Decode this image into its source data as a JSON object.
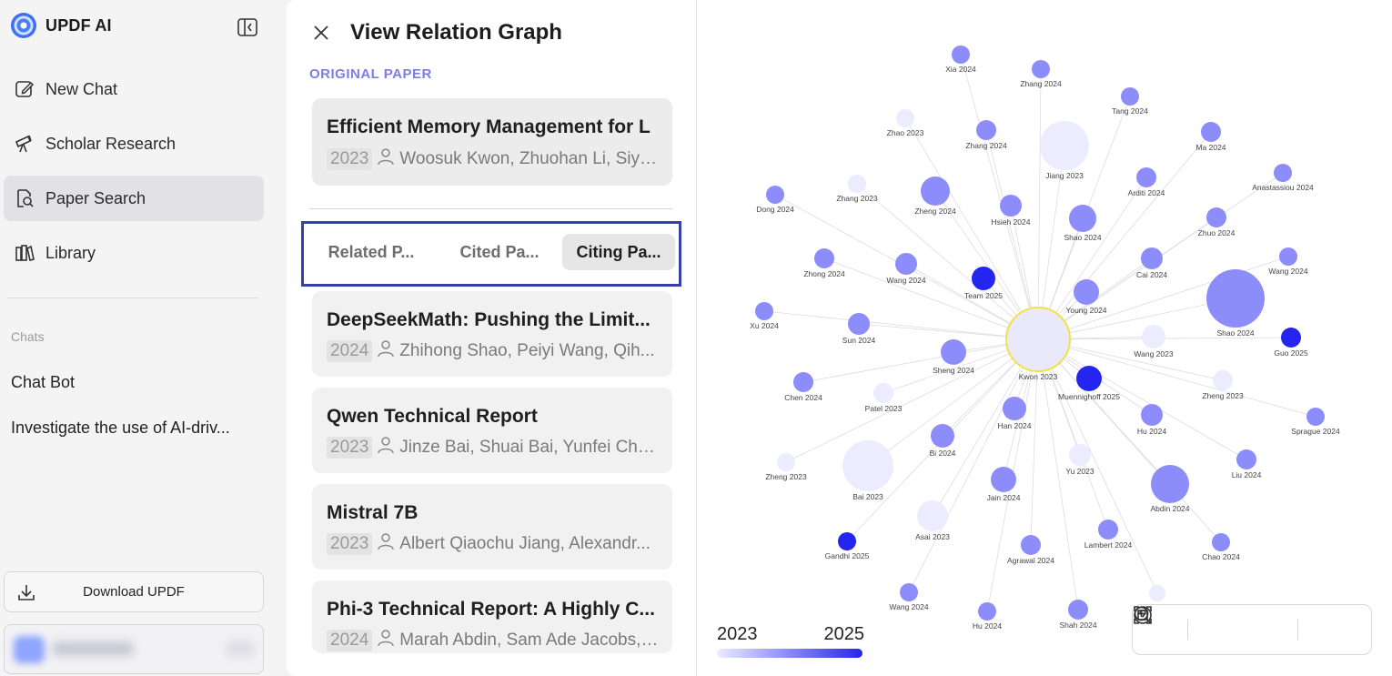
{
  "app": {
    "name": "UPDF AI"
  },
  "sidebar": {
    "items": [
      {
        "label": "New Chat",
        "icon": "edit-icon"
      },
      {
        "label": "Scholar Research",
        "icon": "telescope-icon"
      },
      {
        "label": "Paper Search",
        "icon": "search-document-icon",
        "active": true
      },
      {
        "label": "Library",
        "icon": "library-icon"
      }
    ],
    "chats_label": "Chats",
    "chats": [
      "Chat Bot",
      "Investigate the use of AI-driv..."
    ],
    "download_label": "Download UPDF"
  },
  "panel": {
    "title": "View Relation Graph",
    "original_label": "ORIGINAL PAPER",
    "original": {
      "title": "Efficient Memory Management for L",
      "year": "2023",
      "authors": "Woosuk Kwon, Zhuohan Li, Siyu..."
    },
    "tabs": [
      "Related P...",
      "Cited Pa...",
      "Citing Pa..."
    ],
    "active_tab": 2,
    "papers": [
      {
        "title": "DeepSeekMath: Pushing the Limit...",
        "year": "2024",
        "authors": "Zhihong Shao, Peiyi Wang, Qih..."
      },
      {
        "title": "Qwen Technical Report",
        "year": "2023",
        "authors": "Jinze Bai, Shuai Bai, Yunfei Chu, ..."
      },
      {
        "title": "Mistral 7B",
        "year": "2023",
        "authors": "Albert Qiaochu Jiang, Alexandr..."
      },
      {
        "title": "Phi-3 Technical Report: A Highly C...",
        "year": "2024",
        "authors": "Marah Abdin, Sam Ade Jacobs, ..."
      }
    ]
  },
  "graph": {
    "legend": {
      "min": "2023",
      "max": "2025",
      "color_min": "#ececff",
      "color_max": "#2525f0"
    },
    "center": {
      "label": "Kwon 2023",
      "ring_color": "#f2e24a"
    },
    "nodes": [
      {
        "label": "Xia 2024",
        "year": 2024
      },
      {
        "label": "Zhang 2024",
        "year": 2024
      },
      {
        "label": "Tang 2024",
        "year": 2024
      },
      {
        "label": "Zhao 2023",
        "year": 2023
      },
      {
        "label": "Zhang 2024",
        "year": 2024
      },
      {
        "label": "Jiang 2023",
        "year": 2023
      },
      {
        "label": "Ma 2024",
        "year": 2024
      },
      {
        "label": "Dong 2024",
        "year": 2024
      },
      {
        "label": "Zhang 2023",
        "year": 2023
      },
      {
        "label": "Zheng 2024",
        "year": 2024
      },
      {
        "label": "Hsieh 2024",
        "year": 2024
      },
      {
        "label": "Shao 2024",
        "year": 2024
      },
      {
        "label": "Arditi 2024",
        "year": 2024
      },
      {
        "label": "Anastassiou 2024",
        "year": 2024
      },
      {
        "label": "Zhuo 2024",
        "year": 2024
      },
      {
        "label": "Zhong 2024",
        "year": 2024
      },
      {
        "label": "Wang 2024",
        "year": 2024
      },
      {
        "label": "Team 2025",
        "year": 2025
      },
      {
        "label": "Cai 2024",
        "year": 2024
      },
      {
        "label": "Wang 2024",
        "year": 2024
      },
      {
        "label": "Young 2024",
        "year": 2024
      },
      {
        "label": "Shao 2024",
        "year": 2024
      },
      {
        "label": "Xu 2024",
        "year": 2024
      },
      {
        "label": "Sun 2024",
        "year": 2024
      },
      {
        "label": "Wang 2023",
        "year": 2023
      },
      {
        "label": "Guo 2025",
        "year": 2025
      },
      {
        "label": "Sheng 2024",
        "year": 2024
      },
      {
        "label": "Muennighoff 2025",
        "year": 2025
      },
      {
        "label": "Chen 2024",
        "year": 2024
      },
      {
        "label": "Patel 2023",
        "year": 2023
      },
      {
        "label": "Zheng 2023",
        "year": 2023
      },
      {
        "label": "Han 2024",
        "year": 2024
      },
      {
        "label": "Hu 2024",
        "year": 2024
      },
      {
        "label": "Sprague 2024",
        "year": 2024
      },
      {
        "label": "Bi 2024",
        "year": 2024
      },
      {
        "label": "Yu 2023",
        "year": 2023
      },
      {
        "label": "Zheng 2023",
        "year": 2023
      },
      {
        "label": "Liu 2024",
        "year": 2024
      },
      {
        "label": "Bai 2023",
        "year": 2023
      },
      {
        "label": "Jain 2024",
        "year": 2024
      },
      {
        "label": "Abdin 2024",
        "year": 2024
      },
      {
        "label": "Asai 2023",
        "year": 2023
      },
      {
        "label": "Gandhi 2025",
        "year": 2025
      },
      {
        "label": "Agrawal 2024",
        "year": 2024
      },
      {
        "label": "Lambert 2024",
        "year": 2024
      },
      {
        "label": "Chao 2024",
        "year": 2024
      },
      {
        "label": "Wang 2024",
        "year": 2024
      },
      {
        "label": "Hu 2024",
        "year": 2024
      },
      {
        "label": "Shah 2024",
        "year": 2024
      },
      {
        "label": "",
        "year": 2023
      }
    ]
  },
  "toolbar": {
    "tools": [
      {
        "icon": "fit-screen-icon"
      },
      {
        "icon": "zoom-in-icon"
      },
      {
        "icon": "zoom-out-icon"
      },
      {
        "icon": "help-icon"
      }
    ]
  }
}
